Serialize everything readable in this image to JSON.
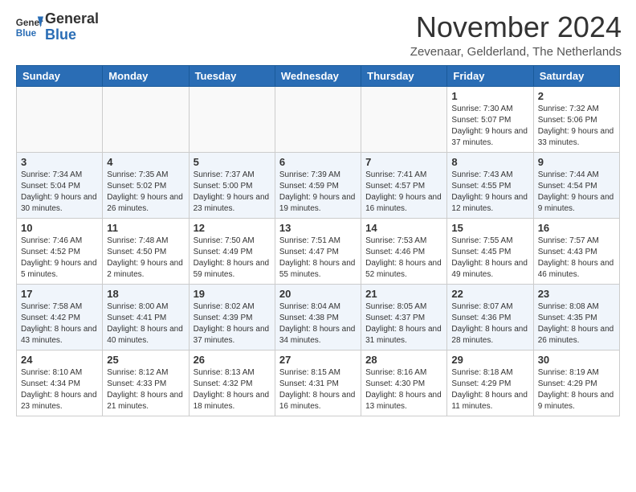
{
  "header": {
    "logo_general": "General",
    "logo_blue": "Blue",
    "month_title": "November 2024",
    "location": "Zevenaar, Gelderland, The Netherlands"
  },
  "days_of_week": [
    "Sunday",
    "Monday",
    "Tuesday",
    "Wednesday",
    "Thursday",
    "Friday",
    "Saturday"
  ],
  "weeks": [
    [
      {
        "day": "",
        "info": ""
      },
      {
        "day": "",
        "info": ""
      },
      {
        "day": "",
        "info": ""
      },
      {
        "day": "",
        "info": ""
      },
      {
        "day": "",
        "info": ""
      },
      {
        "day": "1",
        "info": "Sunrise: 7:30 AM\nSunset: 5:07 PM\nDaylight: 9 hours and 37 minutes."
      },
      {
        "day": "2",
        "info": "Sunrise: 7:32 AM\nSunset: 5:06 PM\nDaylight: 9 hours and 33 minutes."
      }
    ],
    [
      {
        "day": "3",
        "info": "Sunrise: 7:34 AM\nSunset: 5:04 PM\nDaylight: 9 hours and 30 minutes."
      },
      {
        "day": "4",
        "info": "Sunrise: 7:35 AM\nSunset: 5:02 PM\nDaylight: 9 hours and 26 minutes."
      },
      {
        "day": "5",
        "info": "Sunrise: 7:37 AM\nSunset: 5:00 PM\nDaylight: 9 hours and 23 minutes."
      },
      {
        "day": "6",
        "info": "Sunrise: 7:39 AM\nSunset: 4:59 PM\nDaylight: 9 hours and 19 minutes."
      },
      {
        "day": "7",
        "info": "Sunrise: 7:41 AM\nSunset: 4:57 PM\nDaylight: 9 hours and 16 minutes."
      },
      {
        "day": "8",
        "info": "Sunrise: 7:43 AM\nSunset: 4:55 PM\nDaylight: 9 hours and 12 minutes."
      },
      {
        "day": "9",
        "info": "Sunrise: 7:44 AM\nSunset: 4:54 PM\nDaylight: 9 hours and 9 minutes."
      }
    ],
    [
      {
        "day": "10",
        "info": "Sunrise: 7:46 AM\nSunset: 4:52 PM\nDaylight: 9 hours and 5 minutes."
      },
      {
        "day": "11",
        "info": "Sunrise: 7:48 AM\nSunset: 4:50 PM\nDaylight: 9 hours and 2 minutes."
      },
      {
        "day": "12",
        "info": "Sunrise: 7:50 AM\nSunset: 4:49 PM\nDaylight: 8 hours and 59 minutes."
      },
      {
        "day": "13",
        "info": "Sunrise: 7:51 AM\nSunset: 4:47 PM\nDaylight: 8 hours and 55 minutes."
      },
      {
        "day": "14",
        "info": "Sunrise: 7:53 AM\nSunset: 4:46 PM\nDaylight: 8 hours and 52 minutes."
      },
      {
        "day": "15",
        "info": "Sunrise: 7:55 AM\nSunset: 4:45 PM\nDaylight: 8 hours and 49 minutes."
      },
      {
        "day": "16",
        "info": "Sunrise: 7:57 AM\nSunset: 4:43 PM\nDaylight: 8 hours and 46 minutes."
      }
    ],
    [
      {
        "day": "17",
        "info": "Sunrise: 7:58 AM\nSunset: 4:42 PM\nDaylight: 8 hours and 43 minutes."
      },
      {
        "day": "18",
        "info": "Sunrise: 8:00 AM\nSunset: 4:41 PM\nDaylight: 8 hours and 40 minutes."
      },
      {
        "day": "19",
        "info": "Sunrise: 8:02 AM\nSunset: 4:39 PM\nDaylight: 8 hours and 37 minutes."
      },
      {
        "day": "20",
        "info": "Sunrise: 8:04 AM\nSunset: 4:38 PM\nDaylight: 8 hours and 34 minutes."
      },
      {
        "day": "21",
        "info": "Sunrise: 8:05 AM\nSunset: 4:37 PM\nDaylight: 8 hours and 31 minutes."
      },
      {
        "day": "22",
        "info": "Sunrise: 8:07 AM\nSunset: 4:36 PM\nDaylight: 8 hours and 28 minutes."
      },
      {
        "day": "23",
        "info": "Sunrise: 8:08 AM\nSunset: 4:35 PM\nDaylight: 8 hours and 26 minutes."
      }
    ],
    [
      {
        "day": "24",
        "info": "Sunrise: 8:10 AM\nSunset: 4:34 PM\nDaylight: 8 hours and 23 minutes."
      },
      {
        "day": "25",
        "info": "Sunrise: 8:12 AM\nSunset: 4:33 PM\nDaylight: 8 hours and 21 minutes."
      },
      {
        "day": "26",
        "info": "Sunrise: 8:13 AM\nSunset: 4:32 PM\nDaylight: 8 hours and 18 minutes."
      },
      {
        "day": "27",
        "info": "Sunrise: 8:15 AM\nSunset: 4:31 PM\nDaylight: 8 hours and 16 minutes."
      },
      {
        "day": "28",
        "info": "Sunrise: 8:16 AM\nSunset: 4:30 PM\nDaylight: 8 hours and 13 minutes."
      },
      {
        "day": "29",
        "info": "Sunrise: 8:18 AM\nSunset: 4:29 PM\nDaylight: 8 hours and 11 minutes."
      },
      {
        "day": "30",
        "info": "Sunrise: 8:19 AM\nSunset: 4:29 PM\nDaylight: 8 hours and 9 minutes."
      }
    ]
  ]
}
